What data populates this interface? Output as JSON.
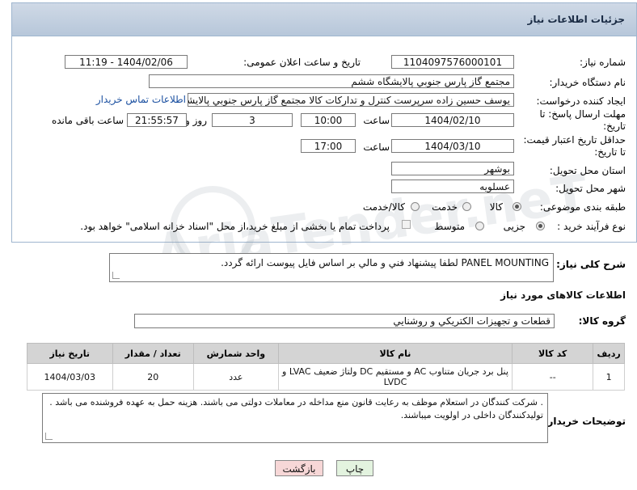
{
  "panel": {
    "title": "جزئیات اطلاعات نیاز"
  },
  "need_number": {
    "label": "شماره نیاز:",
    "value": "1104097576000101"
  },
  "announce": {
    "label": "تاریخ و ساعت اعلان عمومی:",
    "value": "1404/02/06 - 11:19"
  },
  "buyer": {
    "label": "نام دستگاه خریدار:",
    "value": "مجتمع گاز پارس جنوبي  پالايشگاه ششم"
  },
  "creator": {
    "label": "ایجاد کننده درخواست:",
    "value": "يوسف حسين زاده سرپرست کنترل و تدارکات کالا مجتمع گاز پارس جنوبي  پالايشگاه",
    "contact_link": "اطلاعات تماس خریدار"
  },
  "deadline": {
    "label_line1": "مهلت ارسال پاسخ: تا",
    "label_line2": "تاریخ:",
    "date": "1404/02/10",
    "time_label": "ساعت",
    "time": "10:00",
    "days": "3",
    "days_label": "روز و",
    "remaining": "21:55:57",
    "remaining_label": "ساعت باقی مانده"
  },
  "validity": {
    "label_line1": "حداقل تاریخ اعتبار قیمت:",
    "label_line2": "تا تاریخ:",
    "date": "1404/03/10",
    "time_label": "ساعت",
    "time": "17:00"
  },
  "province": {
    "label": "استان محل تحویل:",
    "value": "بوشهر"
  },
  "city": {
    "label": "شهر محل تحویل:",
    "value": "عسلويه"
  },
  "category": {
    "label": "طبقه بندی موضوعی:",
    "options": [
      "کالا",
      "خدمت",
      "کالا/خدمت"
    ],
    "selected": "کالا"
  },
  "process": {
    "label": "نوع فرآیند خرید :",
    "options": [
      "جزیی",
      "متوسط"
    ],
    "selected": "جزیی",
    "note": "پرداخت تمام یا بخشی از مبلغ خرید،از محل \"اسناد خزانه اسلامی\" خواهد بود."
  },
  "description": {
    "label": "شرح کلی نیاز:",
    "value": "PANEL MOUNTING لطفا پيشنهاد فني و مالي بر اساس فايل پيوست ارائه گردد."
  },
  "goods_info": {
    "title": "اطلاعات کالاهای مورد نیاز"
  },
  "goods_group": {
    "label": "گروه کالا:",
    "value": "قطعات و تجهيزات الکتريکي و روشنايي"
  },
  "table": {
    "headers": [
      "ردیف",
      "کد کالا",
      "نام کالا",
      "واحد شمارش",
      "تعداد / مقدار",
      "تاریخ نیاز"
    ],
    "rows": [
      [
        "1",
        "--",
        "پنل برد جریان متناوب AC و مستقیم DC ولتاژ ضعیف LVAC و LVDC",
        "عدد",
        "20",
        "1404/03/03"
      ]
    ]
  },
  "buyer_notes": {
    "label": "توضیحات خریدار:",
    "value": ". شرکت کنندگان در استعلام موظف به رعایت قانون منع مداخله در معاملات دولتی می باشند. هزینه حمل به عهده فروشنده می باشد . تولیدکنندگان داخلی در اولویت میباشند."
  },
  "buttons": {
    "print": "چاپ",
    "back": "بازگشت"
  },
  "watermark": "AriaTender.neT",
  "colors": {
    "header_bg": "#c3d0e0",
    "back_bg": "#f7d7d7",
    "print_bg": "#e3f3df"
  }
}
